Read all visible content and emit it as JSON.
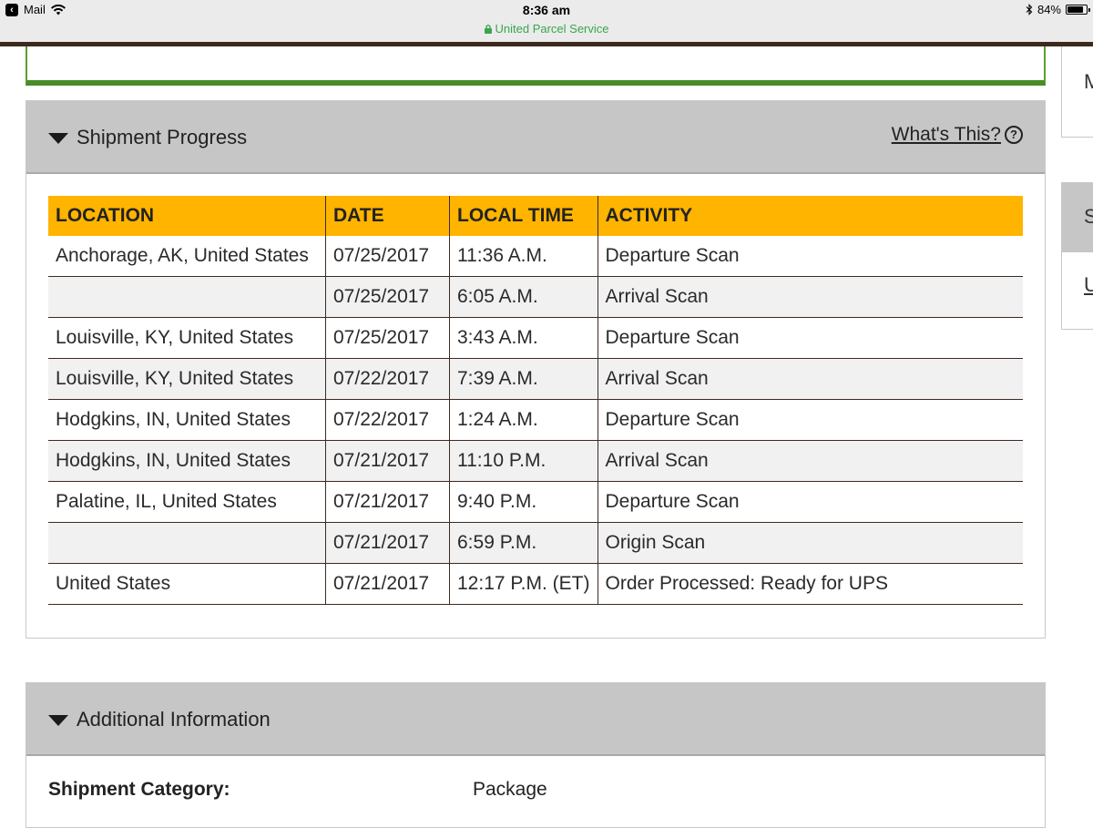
{
  "status_bar": {
    "back_app": "Mail",
    "time": "8:36 am",
    "site": "United Parcel Service",
    "battery": "84%",
    "battery_level": 0.84
  },
  "side_column": {
    "glyph_top": "M",
    "glyph_header": "S",
    "glyph_link": "U"
  },
  "shipment_progress": {
    "title": "Shipment Progress",
    "whats_this": "What's This?",
    "help_glyph": "?",
    "columns": [
      "LOCATION",
      "DATE",
      "LOCAL TIME",
      "ACTIVITY"
    ],
    "rows": [
      {
        "location": "Anchorage,  AK,  United States",
        "date": "07/25/2017",
        "time": "11:36 A.M.",
        "activity": "Departure Scan"
      },
      {
        "location": "",
        "date": "07/25/2017",
        "time": "6:05 A.M.",
        "activity": "Arrival Scan"
      },
      {
        "location": "Louisville,  KY,  United States",
        "date": "07/25/2017",
        "time": "3:43 A.M.",
        "activity": "Departure Scan"
      },
      {
        "location": "Louisville,  KY,  United States",
        "date": "07/22/2017",
        "time": "7:39 A.M.",
        "activity": "Arrival Scan"
      },
      {
        "location": "Hodgkins,  IN,  United States",
        "date": "07/22/2017",
        "time": "1:24 A.M.",
        "activity": "Departure Scan"
      },
      {
        "location": "Hodgkins,  IN,  United States",
        "date": "07/21/2017",
        "time": "11:10 P.M.",
        "activity": "Arrival Scan"
      },
      {
        "location": "Palatine,  IL,  United States",
        "date": "07/21/2017",
        "time": "9:40 P.M.",
        "activity": "Departure Scan"
      },
      {
        "location": "",
        "date": "07/21/2017",
        "time": "6:59 P.M.",
        "activity": "Origin Scan"
      },
      {
        "location": "United States",
        "date": "07/21/2017",
        "time": "12:17 P.M. (ET)",
        "activity": "Order Processed: Ready for UPS"
      }
    ]
  },
  "additional_information": {
    "title": "Additional Information",
    "shipment_category_label": "Shipment Category:",
    "shipment_category_value": "Package"
  },
  "colors": {
    "table_header": "#ffb400",
    "panel_header": "#c6c6c6",
    "ups_brown": "#3d2a1f",
    "green_accent": "#4a8b2a",
    "secure_green": "#3aa64b"
  }
}
